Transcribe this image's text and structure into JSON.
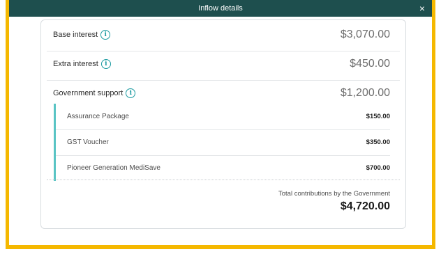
{
  "dialog": {
    "title": "Inflow details",
    "close_label": "×"
  },
  "rows": [
    {
      "label": "Base interest",
      "amount": "$3,070.00",
      "info_icon": "info-icon"
    },
    {
      "label": "Extra interest",
      "amount": "$450.00",
      "info_icon": "info-icon"
    },
    {
      "label": "Government support",
      "amount": "$1,200.00",
      "info_icon": "info-icon"
    }
  ],
  "government_support_items": [
    {
      "label": "Assurance Package",
      "amount": "$150.00"
    },
    {
      "label": "GST Voucher",
      "amount": "$350.00"
    },
    {
      "label": "Pioneer Generation MediSave",
      "amount": "$700.00"
    }
  ],
  "total": {
    "label": "Total contributions by the Government",
    "amount": "$4,720.00"
  },
  "colors": {
    "header": "#1e4f4e",
    "frame": "#f5b800",
    "accent": "#59c4c4",
    "info": "#1a9aa0"
  }
}
